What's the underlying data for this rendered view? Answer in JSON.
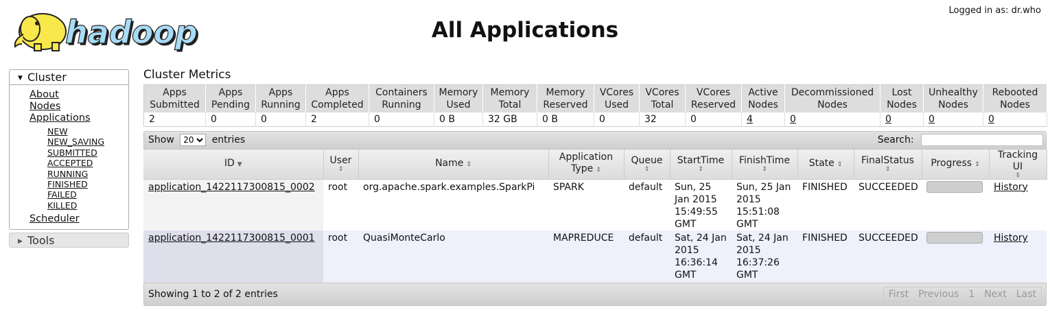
{
  "header": {
    "page_title": "All Applications",
    "logged_in": "Logged in as: dr.who",
    "logo_alt": "hadoop"
  },
  "sidebar": {
    "cluster_label": "Cluster",
    "about": "About",
    "nodes": "Nodes",
    "applications": "Applications",
    "app_states": [
      "NEW",
      "NEW_SAVING",
      "SUBMITTED",
      "ACCEPTED",
      "RUNNING",
      "FINISHED",
      "FAILED",
      "KILLED"
    ],
    "scheduler": "Scheduler",
    "tools_label": "Tools"
  },
  "metrics": {
    "title": "Cluster Metrics",
    "headers": [
      "Apps Submitted",
      "Apps Pending",
      "Apps Running",
      "Apps Completed",
      "Containers Running",
      "Memory Used",
      "Memory Total",
      "Memory Reserved",
      "VCores Used",
      "VCores Total",
      "VCores Reserved",
      "Active Nodes",
      "Decommissioned Nodes",
      "Lost Nodes",
      "Unhealthy Nodes",
      "Rebooted Nodes"
    ],
    "values": [
      "2",
      "0",
      "0",
      "2",
      "0",
      "0 B",
      "32 GB",
      "0 B",
      "0",
      "32",
      "0",
      "4",
      "0",
      "0",
      "0",
      "0"
    ]
  },
  "table_controls": {
    "show_label": "Show",
    "page_size": "20",
    "entries_label": "entries",
    "search_label": "Search:",
    "search_value": ""
  },
  "apps_table": {
    "headers": {
      "id": "ID",
      "user": "User",
      "name": "Name",
      "app_type": "Application Type",
      "queue": "Queue",
      "start": "StartTime",
      "finish": "FinishTime",
      "state": "State",
      "final_status": "FinalStatus",
      "progress": "Progress",
      "tracking": "Tracking UI"
    },
    "rows": [
      {
        "id": "application_1422117300815_0002",
        "user": "root",
        "name": "org.apache.spark.examples.SparkPi",
        "app_type": "SPARK",
        "queue": "default",
        "start": "Sun, 25 Jan 2015 15:49:55 GMT",
        "finish": "Sun, 25 Jan 2015 15:51:08 GMT",
        "state": "FINISHED",
        "final_status": "SUCCEEDED",
        "progress": 1.0,
        "tracking": "History"
      },
      {
        "id": "application_1422117300815_0001",
        "user": "root",
        "name": "QuasiMonteCarlo",
        "app_type": "MAPREDUCE",
        "queue": "default",
        "start": "Sat, 24 Jan 2015 16:36:14 GMT",
        "finish": "Sat, 24 Jan 2015 16:37:26 GMT",
        "state": "FINISHED",
        "final_status": "SUCCEEDED",
        "progress": 1.0,
        "tracking": "History"
      }
    ]
  },
  "footer": {
    "info": "Showing 1 to 2 of 2 entries",
    "first": "First",
    "previous": "Previous",
    "page": "1",
    "next": "Next",
    "last": "Last"
  }
}
